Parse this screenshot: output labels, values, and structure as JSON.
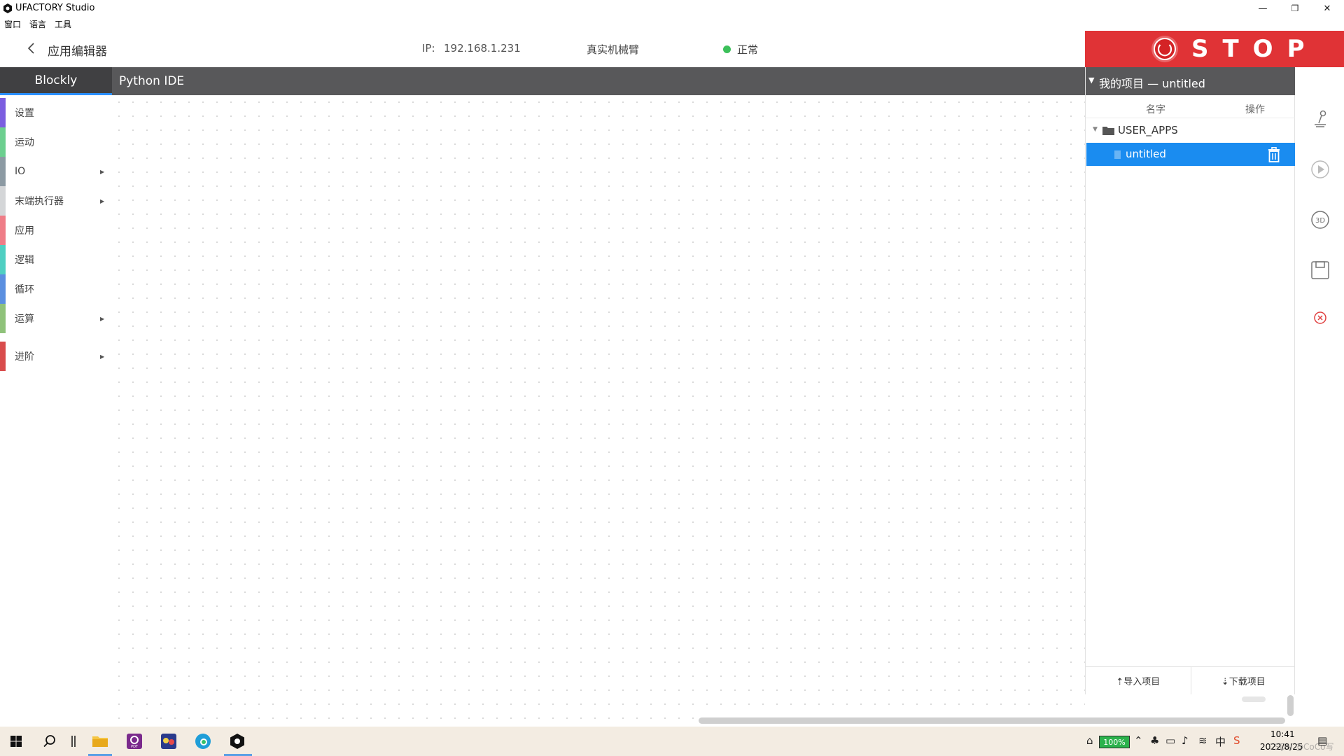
{
  "window": {
    "title": "UFACTORY Studio",
    "minimize": "—",
    "restore": "❐",
    "close": "✕"
  },
  "menu": {
    "items": [
      "窗口",
      "语言",
      "工具"
    ]
  },
  "header": {
    "title": "应用编辑器",
    "ip_label": "IP:",
    "ip_value": "192.168.1.231",
    "robot_mode": "真实机械臂",
    "status": "正常",
    "status_color": "#3cc05a"
  },
  "stop": {
    "label": "STOP",
    "color": "#e03336"
  },
  "tabs": [
    {
      "label": "Blockly",
      "active": true
    },
    {
      "label": "Python IDE",
      "active": false
    }
  ],
  "categories": [
    {
      "label": "设置",
      "color": "#7b5ee0",
      "submenu": false
    },
    {
      "label": "运动",
      "color": "#6ccf8f",
      "submenu": false
    },
    {
      "label": "IO",
      "color": "#8c9aa3",
      "submenu": true
    },
    {
      "label": "末端执行器",
      "color": "#d4d6d8",
      "submenu": true
    },
    {
      "label": "应用",
      "color": "#ef7d87",
      "submenu": false
    },
    {
      "label": "逻辑",
      "color": "#4fcfc2",
      "submenu": false
    },
    {
      "label": "循环",
      "color": "#5a8fe0",
      "submenu": false
    },
    {
      "label": "运算",
      "color": "#8fc27a",
      "submenu": true
    },
    {
      "label": "进阶",
      "color": "#d94c4c",
      "submenu": true
    }
  ],
  "project": {
    "header": "我的项目 — untitled",
    "col_name": "名字",
    "col_action": "操作",
    "folder": "USER_APPS",
    "file": "untitled",
    "import_label": "⇡导入项目",
    "download_label": "⇣下载项目"
  },
  "rail": {
    "icons": [
      "robot-arm-icon",
      "play-icon",
      "3d-view-icon",
      "save-icon",
      "close-circle-icon"
    ]
  },
  "taskbar": {
    "battery": "100%",
    "time": "10:41",
    "date": "2022/8/25",
    "watermark": "CSDN @CoCo写"
  }
}
